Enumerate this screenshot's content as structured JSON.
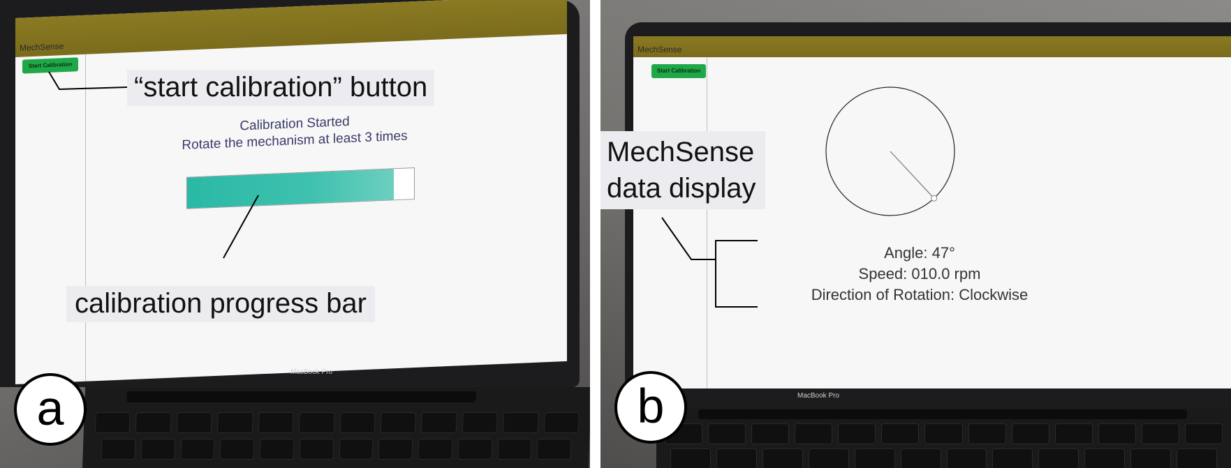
{
  "panel_a": {
    "app_title": "MechSense",
    "start_button_label": "Start Calibration",
    "status_line1": "Calibration Started",
    "status_line2": "Rotate the mechanism at least 3 times",
    "progress_fraction": 0.91,
    "progress_color": "#2ab9a6",
    "callout_button": "“start calibration” button",
    "callout_progress": "calibration progress bar",
    "laptop_label": "MacBook Pro",
    "panel_letter": "a"
  },
  "panel_b": {
    "app_title": "MechSense",
    "start_button_label": "Start Calibration",
    "callout_display_line1": "MechSense",
    "callout_display_line2": "data display",
    "angle_label": "Angle: 47°",
    "speed_label": "Speed:  010.0 rpm",
    "direction_label": "Direction of Rotation: Clockwise",
    "angle_degrees": 47,
    "laptop_label": "MacBook Pro",
    "panel_letter": "b"
  },
  "colors": {
    "appbar": "#7b6c1d",
    "button_green": "#1fa847",
    "callout_bg": "#ececf0"
  }
}
